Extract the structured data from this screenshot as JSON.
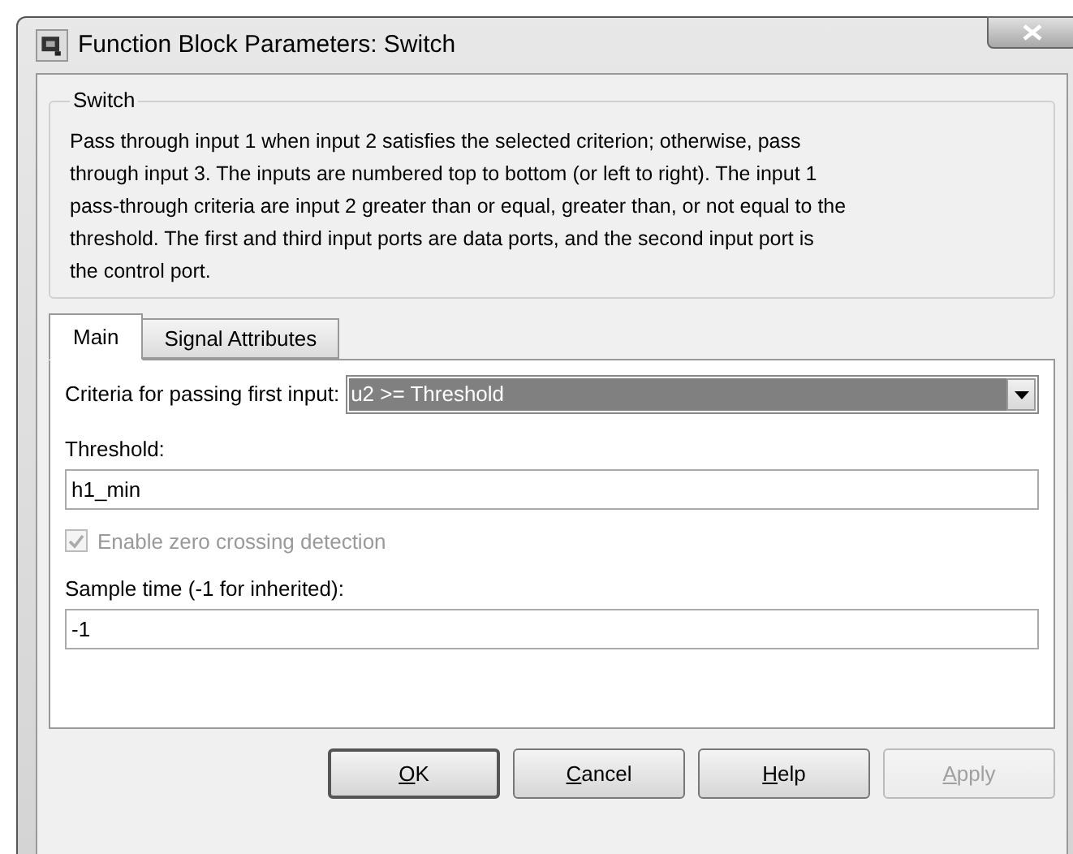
{
  "window": {
    "title": "Function Block Parameters: Switch"
  },
  "group": {
    "title": "Switch",
    "description_lines": [
      "Pass through input 1 when input 2 satisfies the selected criterion; otherwise, pass",
      "through input 3.  The inputs are numbered top to bottom (or left to right). The input 1",
      "pass-through criteria are input 2 greater than or equal, greater than, or not equal to the",
      "threshold.  The first and third input ports are data ports, and the second input port is",
      "the control port."
    ]
  },
  "tabs": [
    {
      "label": "Main",
      "selected": true
    },
    {
      "label": "Signal Attributes",
      "selected": false
    }
  ],
  "criteria": {
    "label": "Criteria for passing first input:",
    "value": "u2 >= Threshold",
    "focused": true
  },
  "threshold": {
    "label": "Threshold:",
    "value": "h1_min"
  },
  "zero_crossing": {
    "label": "Enable zero crossing detection",
    "checked": true,
    "disabled": true
  },
  "sample_time": {
    "label": "Sample time (-1 for inherited):",
    "value": "-1"
  },
  "buttons": [
    {
      "accel": "O",
      "rest": "K",
      "default": true,
      "disabled": false
    },
    {
      "accel": "C",
      "rest": "ancel",
      "default": false,
      "disabled": false
    },
    {
      "accel": "H",
      "rest": "elp",
      "default": false,
      "disabled": false
    },
    {
      "accel": "A",
      "rest": "pply",
      "default": false,
      "disabled": true
    }
  ]
}
